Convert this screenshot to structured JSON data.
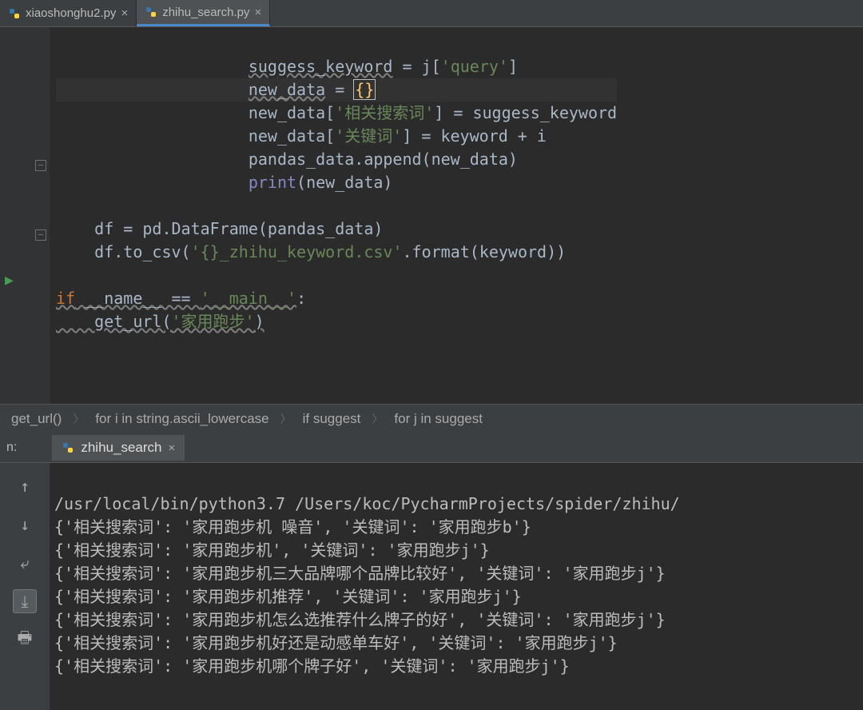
{
  "tabs": [
    {
      "label": "xiaoshonghu2.py",
      "active": false
    },
    {
      "label": "zhihu_search.py",
      "active": true
    }
  ],
  "code_tokens": {
    "l1": "                    suggess_keyword = j['query']",
    "l2a": "                    ",
    "l2b": "new_data",
    "l2c": " = ",
    "l2d": "{}",
    "l3a": "                    new_data[",
    "l3b": "'相关搜索词'",
    "l3c": "] = suggess_keyword",
    "l4a": "                    new_data[",
    "l4b": "'关键词'",
    "l4c": "] = keyword + i",
    "l5": "                    pandas_data.append(new_data)",
    "l6a": "                    ",
    "l6b": "print",
    "l6c": "(new_data)",
    "l8": "    df = pd.DataFrame(pandas_data)",
    "l9a": "    df.to_csv(",
    "l9b": "'{}_zhihu_keyword.csv'",
    "l9c": ".format(keyword))",
    "l11a": "if",
    "l11b": " __name__ == ",
    "l11c": "'__main__'",
    "l11d": ":",
    "l12a": "    get_url(",
    "l12b": "'家用跑步'",
    "l12c": ")"
  },
  "breadcrumb": {
    "items": [
      "get_url()",
      "for i in string.ascii_lowercase",
      "if suggest",
      "for j in suggest"
    ]
  },
  "run": {
    "panel_label": "n:",
    "tab_label": "zhihu_search",
    "lines": [
      "/usr/local/bin/python3.7 /Users/koc/PycharmProjects/spider/zhihu/",
      "{'相关搜索词': '家用跑步机 噪音', '关键词': '家用跑步b'}",
      "{'相关搜索词': '家用跑步机', '关键词': '家用跑步j'}",
      "{'相关搜索词': '家用跑步机三大品牌哪个品牌比较好', '关键词': '家用跑步j'}",
      "{'相关搜索词': '家用跑步机推荐', '关键词': '家用跑步j'}",
      "{'相关搜索词': '家用跑步机怎么选推荐什么牌子的好', '关键词': '家用跑步j'}",
      "{'相关搜索词': '家用跑步机好还是动感单车好', '关键词': '家用跑步j'}",
      "{'相关搜索词': '家用跑步机哪个牌子好', '关键词': '家用跑步j'}"
    ]
  }
}
